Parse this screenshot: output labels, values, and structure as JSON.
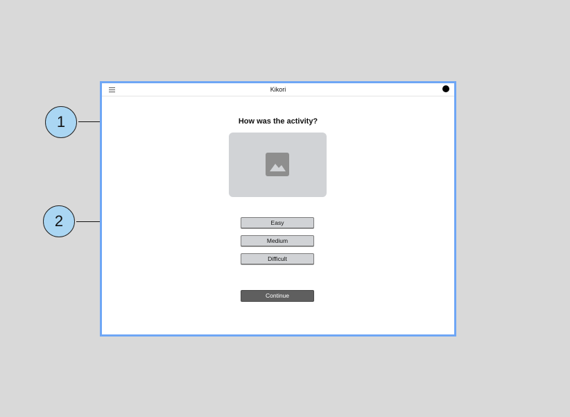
{
  "header": {
    "title": "Kikori"
  },
  "main": {
    "question": "How was the activity?",
    "options": [
      "Easy",
      "Medium",
      "Difficult"
    ],
    "continue_label": "Continue"
  },
  "annotations": [
    "1",
    "2"
  ],
  "colors": {
    "background": "#d9d9d9",
    "frame_border": "#6ea6f5",
    "badge_fill": "#aad6f3",
    "placeholder": "#d1d3d6",
    "continue_button": "#5f5f5f"
  },
  "icons": {
    "menu": "hamburger-menu-icon",
    "avatar": "avatar",
    "image": "image-placeholder-icon"
  }
}
